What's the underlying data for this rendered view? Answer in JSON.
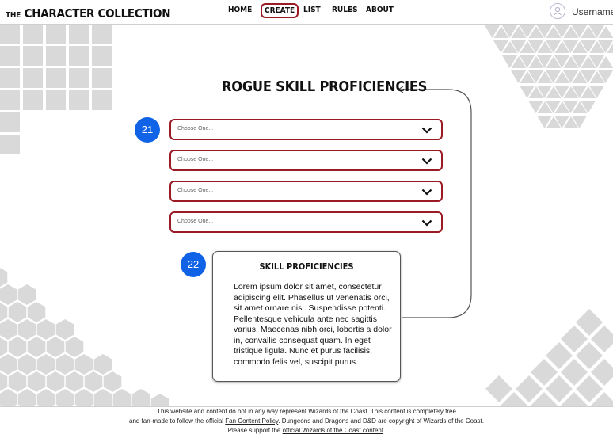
{
  "header": {
    "logo_the": "THE",
    "logo_main": "CHARACTER COLLECTION",
    "nav": [
      {
        "label": "HOME",
        "active": false
      },
      {
        "label": "CREATE",
        "active": true
      },
      {
        "label": "LIST",
        "active": false
      },
      {
        "label": "RULES",
        "active": false
      },
      {
        "label": "ABOUT",
        "active": false
      }
    ],
    "username": "Username"
  },
  "main": {
    "title": "ROGUE SKILL PROFICIENCIES",
    "step_select": "21",
    "step_card": "22",
    "selects": [
      {
        "placeholder": "Choose One..."
      },
      {
        "placeholder": "Choose One..."
      },
      {
        "placeholder": "Choose One..."
      },
      {
        "placeholder": "Choose One..."
      }
    ],
    "card": {
      "title": "SKILL PROFICIENCIES",
      "body": "Lorem ipsum dolor sit amet, consectetur adipiscing elit. Phasellus ut  venenatis orci, sit amet ornare nisi. Suspendisse potenti. Pellentesque  vehicula ante nec sagittis varius. Maecenas nibh orci, lobortis a dolor in, convallis consequat quam. In eget tristique ligula. Nunc et purus  facilisis, commodo felis vel, suscipit purus."
    }
  },
  "footer": {
    "line1": "This website and content do not in any way represent Wizards of the Coast. This content is completely free",
    "line2_pre": "and fan-made to follow the official ",
    "line2_link": "Fan Content Policy",
    "line2_post": ". Dungeons and Dragons and D&D are copyright of Wizards of the Coast.",
    "line3_pre": "Please support the ",
    "line3_link": "official Wizards of the Coast content",
    "line3_post": "."
  },
  "colors": {
    "accent": "#9b1b24",
    "badge": "#1062e6",
    "pattern": "#d9d9d9"
  },
  "icons": [
    "user-icon",
    "chevron-down-icon"
  ]
}
